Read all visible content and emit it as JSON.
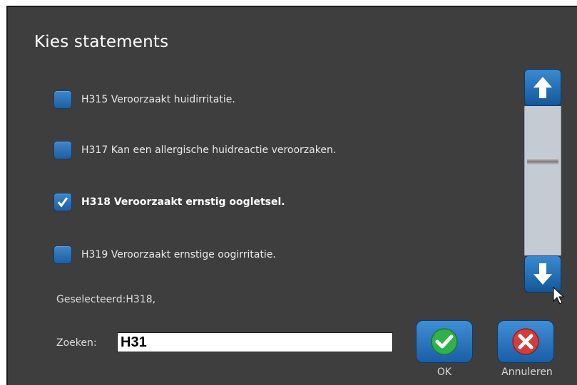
{
  "dialog": {
    "title": "Kies statements"
  },
  "statements": [
    {
      "label": "H315 Veroorzaakt huidirritatie.",
      "checked": false
    },
    {
      "label": "H317 Kan een allergische huidreactie veroorzaken.",
      "checked": false
    },
    {
      "label": "H318 Veroorzaakt ernstig oogletsel.",
      "checked": true
    },
    {
      "label": "H319 Veroorzaakt ernstige oogirritatie.",
      "checked": false
    }
  ],
  "selected_text": "Geselecteerd:H318,",
  "search": {
    "label": "Zoeken:",
    "value": "H31"
  },
  "buttons": {
    "ok_label": "OK",
    "cancel_label": "Annuleren"
  },
  "colors": {
    "background": "#3e3e3e",
    "button_blue": "#1d5fa3",
    "ok_green": "#2fb24a",
    "cancel_red": "#d63b3b"
  }
}
